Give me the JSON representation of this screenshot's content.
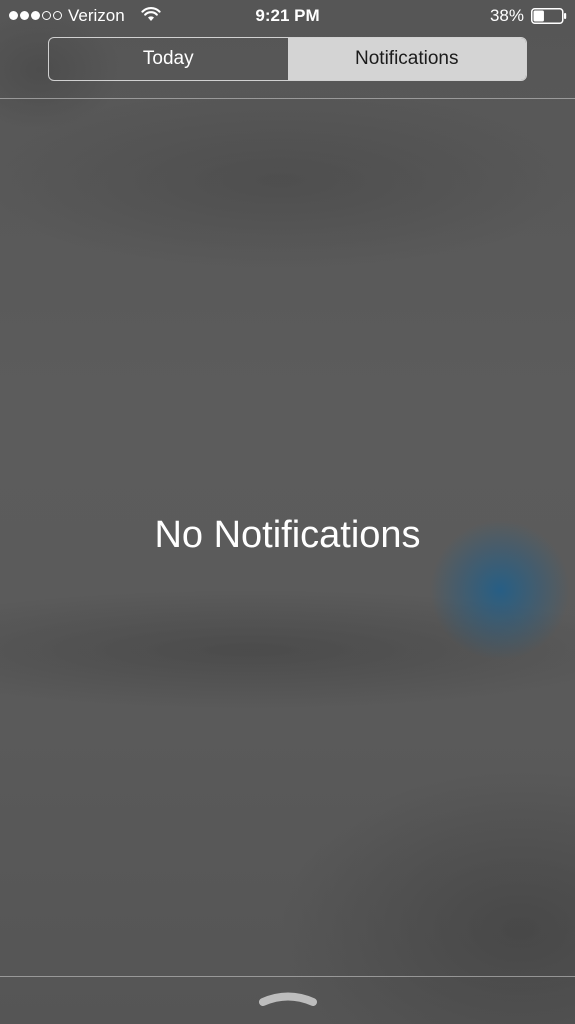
{
  "status_bar": {
    "signal_bars_filled": 3,
    "signal_bars_total": 5,
    "carrier": "Verizon",
    "wifi_icon": "wifi-icon",
    "time": "9:21 PM",
    "battery_percent": "38%",
    "battery_level": 0.38,
    "battery_icon": "battery-icon"
  },
  "segmented_control": {
    "tabs": [
      {
        "label": "Today",
        "selected": false
      },
      {
        "label": "Notifications",
        "selected": true
      }
    ]
  },
  "main": {
    "empty_message": "No Notifications"
  },
  "footer": {
    "grabber_icon": "grabber-handle-icon"
  },
  "colors": {
    "background": "#5b5b5b",
    "selected_tab_bg": "#d4d4d4",
    "text": "#ffffff"
  }
}
